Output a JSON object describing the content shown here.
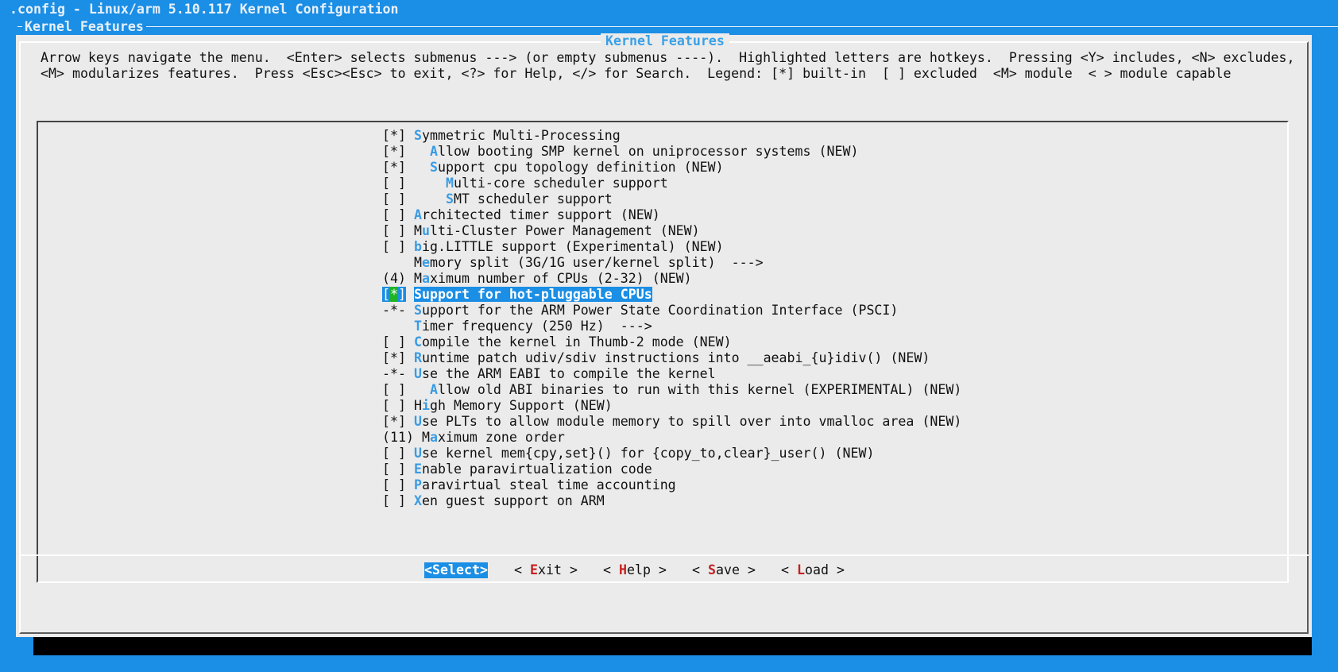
{
  "window": {
    "title": ".config - Linux/arm 5.10.117 Kernel Configuration",
    "breadcrumb": "Kernel Features"
  },
  "dialog": {
    "title": "Kernel Features",
    "help_line1": "Arrow keys navigate the menu.  <Enter> selects submenus ---> (or empty submenus ----).  Highlighted letters are hotkeys.  Pressing <Y> includes, <N> excludes,",
    "help_line2": "<M> modularizes features.  Press <Esc><Esc> to exit, <?> for Help, </> for Search.  Legend: [*] built-in  [ ] excluded  <M> module  < > module capable"
  },
  "menu": {
    "items": [
      {
        "mark": "[*]",
        "indent": "",
        "hotkey": "S",
        "rest": "ymmetric Multi-Processing"
      },
      {
        "mark": "[*]",
        "indent": "  ",
        "hotkey": "A",
        "rest": "llow booting SMP kernel on uniprocessor systems (NEW)"
      },
      {
        "mark": "[*]",
        "indent": "  ",
        "hotkey": "S",
        "rest": "upport cpu topology definition (NEW)"
      },
      {
        "mark": "[ ]",
        "indent": "    ",
        "hotkey": "M",
        "pre": "",
        "rest": "ulti-core scheduler support"
      },
      {
        "mark": "[ ]",
        "indent": "    ",
        "hotkey": "S",
        "rest": "MT scheduler support"
      },
      {
        "mark": "[ ]",
        "indent": "",
        "hotkey": "A",
        "rest": "rchitected timer support (NEW)"
      },
      {
        "mark": "[ ]",
        "indent": "",
        "pre": "M",
        "hotkey": "u",
        "rest": "lti-Cluster Power Management (NEW)"
      },
      {
        "mark": "[ ]",
        "indent": "",
        "hotkey": "b",
        "rest": "ig.LITTLE support (Experimental) (NEW)"
      },
      {
        "mark": "   ",
        "indent": "",
        "pre": "M",
        "hotkey": "e",
        "rest": "mory split (3G/1G user/kernel split)  --->"
      },
      {
        "mark": "(4)",
        "indent": "",
        "pre": "M",
        "hotkey": "a",
        "rest": "ximum number of CPUs (2-32) (NEW)"
      },
      {
        "mark": "[*]",
        "indent": "",
        "hotkey": "S",
        "rest": "upport for hot-pluggable CPUs",
        "selected": true
      },
      {
        "mark": "-*-",
        "indent": "",
        "hotkey": "S",
        "rest": "upport for the ARM Power State Coordination Interface (PSCI)"
      },
      {
        "mark": "   ",
        "indent": "",
        "hotkey": "T",
        "rest": "imer frequency (250 Hz)  --->"
      },
      {
        "mark": "[ ]",
        "indent": "",
        "hotkey": "C",
        "rest": "ompile the kernel in Thumb-2 mode (NEW)"
      },
      {
        "mark": "[*]",
        "indent": "",
        "hotkey": "R",
        "rest": "untime patch udiv/sdiv instructions into __aeabi_{u}idiv() (NEW)"
      },
      {
        "mark": "-*-",
        "indent": "",
        "hotkey": "U",
        "rest": "se the ARM EABI to compile the kernel"
      },
      {
        "mark": "[ ]",
        "indent": "  ",
        "hotkey": "A",
        "rest": "llow old ABI binaries to run with this kernel (EXPERIMENTAL) (NEW)"
      },
      {
        "mark": "[ ]",
        "indent": "",
        "pre": "H",
        "hotkey": "i",
        "rest": "gh Memory Support (NEW)"
      },
      {
        "mark": "[*]",
        "indent": "",
        "hotkey": "U",
        "rest": "se PLTs to allow module memory to spill over into vmalloc area (NEW)"
      },
      {
        "mark": "(11)",
        "indent": "",
        "pre": "M",
        "hotkey": "a",
        "rest": "ximum zone order"
      },
      {
        "mark": "[ ]",
        "indent": "",
        "hotkey": "U",
        "rest": "se kernel mem{cpy,set}() for {copy_to,clear}_user() (NEW)"
      },
      {
        "mark": "[ ]",
        "indent": "",
        "hotkey": "E",
        "rest": "nable paravirtualization code"
      },
      {
        "mark": "[ ]",
        "indent": "",
        "hotkey": "P",
        "rest": "aravirtual steal time accounting"
      },
      {
        "mark": "[ ]",
        "indent": "",
        "hotkey": "X",
        "rest": "en guest support on ARM"
      }
    ]
  },
  "buttons": [
    {
      "id": "select",
      "pre": "<",
      "hotkey": "S",
      "rest": "elect>",
      "active": true
    },
    {
      "id": "exit",
      "pre": "< ",
      "hotkey": "E",
      "rest": "xit >"
    },
    {
      "id": "help",
      "pre": "< ",
      "hotkey": "H",
      "rest": "elp >"
    },
    {
      "id": "save",
      "pre": "< ",
      "hotkey": "S",
      "rest": "ave >"
    },
    {
      "id": "load",
      "pre": "< ",
      "hotkey": "L",
      "rest": "oad >"
    }
  ],
  "colors": {
    "background": "#1b8ee5",
    "dialog": "#ebebeb",
    "hotkey": "#3a9be3",
    "button_hotkey": "#c42020",
    "cursor": "#1fb428"
  }
}
